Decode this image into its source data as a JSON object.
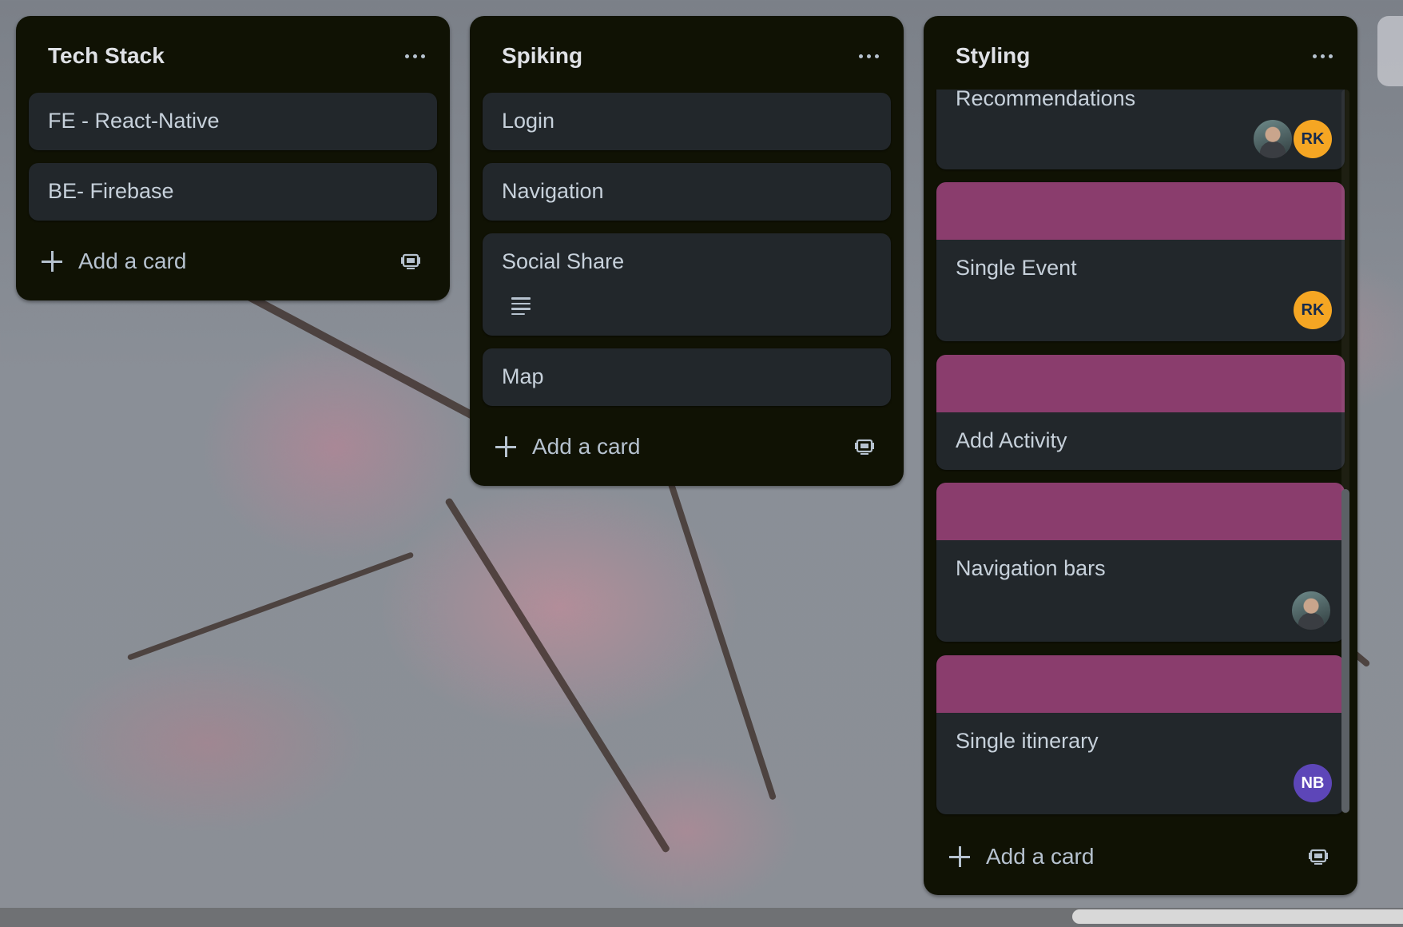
{
  "lists": [
    {
      "title": "Tech Stack",
      "cards": [
        {
          "title": "FE - React-Native"
        },
        {
          "title": "BE- Firebase"
        }
      ],
      "add_card_label": "Add a card"
    },
    {
      "title": "Spiking",
      "cards": [
        {
          "title": "Login"
        },
        {
          "title": "Navigation"
        },
        {
          "title": "Social Share",
          "has_description": true
        },
        {
          "title": "Map"
        }
      ],
      "add_card_label": "Add a card"
    },
    {
      "title": "Styling",
      "cards": [
        {
          "title": "Recommendations",
          "members": [
            "photo",
            "RK"
          ]
        },
        {
          "title": "Single Event",
          "cover": "#8a3d6d",
          "members": [
            "RK"
          ]
        },
        {
          "title": "Add Activity",
          "cover": "#8a3d6d"
        },
        {
          "title": "Navigation bars",
          "cover": "#8a3d6d",
          "members": [
            "photo"
          ]
        },
        {
          "title": "Single itinerary",
          "cover": "#8a3d6d",
          "members": [
            "NB"
          ]
        }
      ],
      "add_card_label": "Add a card"
    }
  ],
  "members": {
    "RK": {
      "initials": "RK",
      "color": "#f5a623",
      "text_color": "#172b4d"
    },
    "NB": {
      "initials": "NB",
      "color": "#5d46b8",
      "text_color": "#ffffff"
    }
  },
  "colors": {
    "list_bg": "#101204",
    "card_bg": "#22272b",
    "cover_magenta": "#8a3d6d"
  },
  "icons": {
    "list_menu": "more-horizontal-icon",
    "add": "plus-icon",
    "template": "card-template-icon",
    "description": "description-icon"
  }
}
